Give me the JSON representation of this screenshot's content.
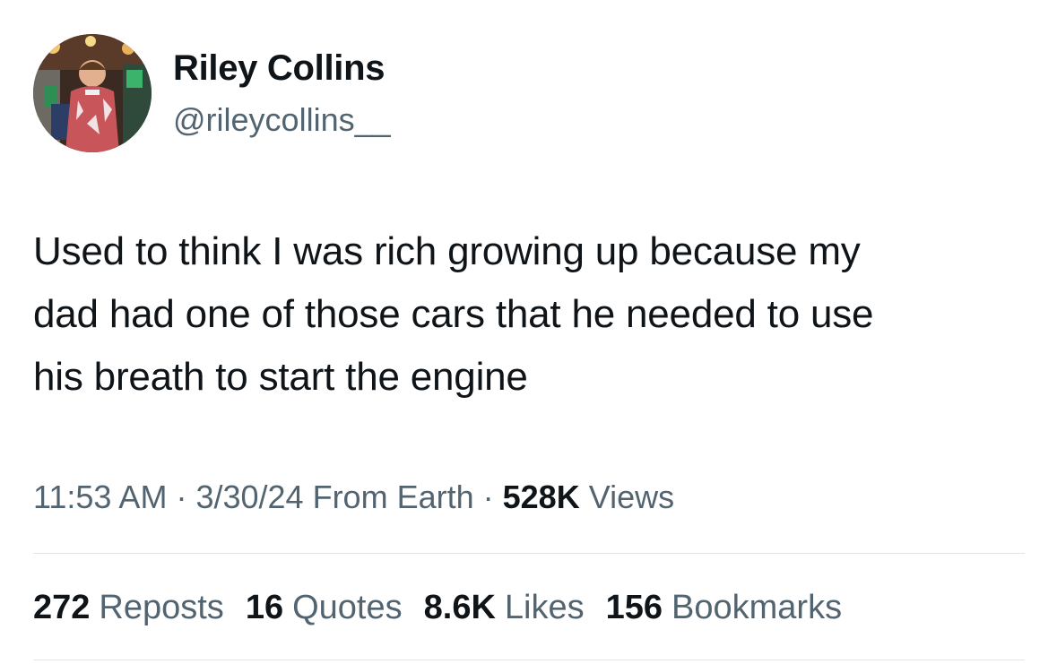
{
  "author": {
    "display_name": "Riley Collins",
    "handle": "@rileycollins__",
    "avatar_icon": "profile-photo"
  },
  "tweet": {
    "text": "Used to think I was rich growing up because my\ndad had one of those cars that he needed to use\nhis breath to start the engine"
  },
  "meta": {
    "time": "11:53 AM",
    "separator": "·",
    "date": "3/30/24",
    "source": "From Earth",
    "views_count": "528K",
    "views_label": "Views"
  },
  "stats": [
    {
      "count": "272",
      "label": "Reposts"
    },
    {
      "count": "16",
      "label": "Quotes"
    },
    {
      "count": "8.6K",
      "label": "Likes"
    },
    {
      "count": "156",
      "label": "Bookmarks"
    }
  ],
  "colors": {
    "text_primary": "#0f1419",
    "text_secondary": "#536471",
    "divider": "#e1e5e8"
  }
}
